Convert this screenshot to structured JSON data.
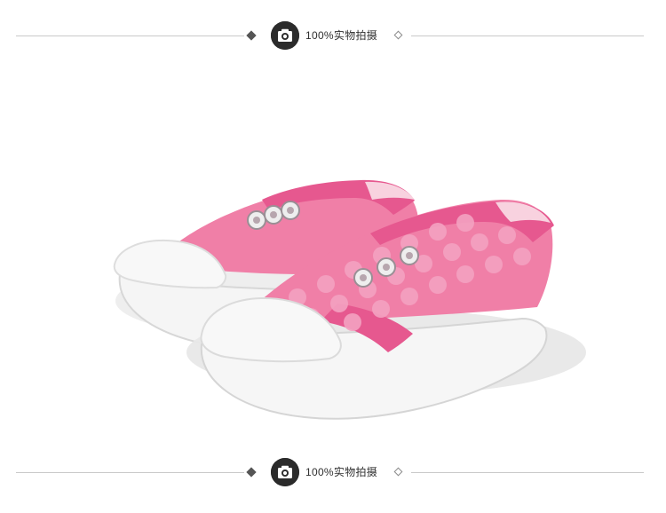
{
  "top_divider": {
    "caption": "100%实物拍摄",
    "badge_icon": "camera-icon"
  },
  "bottom_divider": {
    "caption": "100%实物拍摄",
    "badge_icon": "camera-icon"
  },
  "product": {
    "icon": "shoes-image",
    "colors": {
      "upper": "#f07fa7",
      "trim": "#e6588f",
      "sole": "#f5f5f5",
      "eyelet": "#eeeeee"
    }
  }
}
